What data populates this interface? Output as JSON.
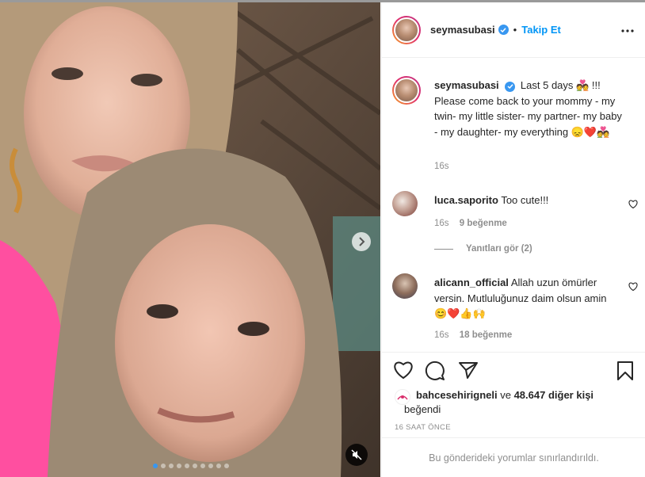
{
  "post": {
    "username": "seymasubasi",
    "follow_label": "Takip Et",
    "separator": "•",
    "caption": {
      "username": "seymasubasi",
      "text_before": "Last 5 days",
      "text_after": "!!! Please come back to your mommy - my twin- my little sister- my partner- my baby - my daughter- my everything",
      "time": "16s"
    },
    "carousel": {
      "count": 10,
      "active_index": 0
    }
  },
  "comments": [
    {
      "username": "luca.saporito",
      "text": "Too cute!!!",
      "time": "16s",
      "likes": "9 beğenme",
      "replies": "Yanıtları gör (2)"
    },
    {
      "username": "alicann_official",
      "text": "Allah uzun ömürler versin. Mutluluğunuz daim olsun amin",
      "time": "16s",
      "likes": "18 beğenme"
    }
  ],
  "likes": {
    "user": "bahcesehirigneli",
    "connector": "ve",
    "others": "48.647 diğer kişi",
    "suffix": "beğendi"
  },
  "timestamp": "16 SAAT ÖNCE",
  "restricted_notice": "Bu gönderideki yorumlar sınırlandırıldı.",
  "colors": {
    "accent": "#0095f6",
    "verified": "#3897f0",
    "muted": "#8e8e8e",
    "heart_red": "#ed4956"
  },
  "icons": [
    "verified-icon",
    "more-options-icon",
    "heart-icon",
    "comment-icon",
    "share-icon",
    "save-icon",
    "next-arrow-icon",
    "mute-icon"
  ]
}
